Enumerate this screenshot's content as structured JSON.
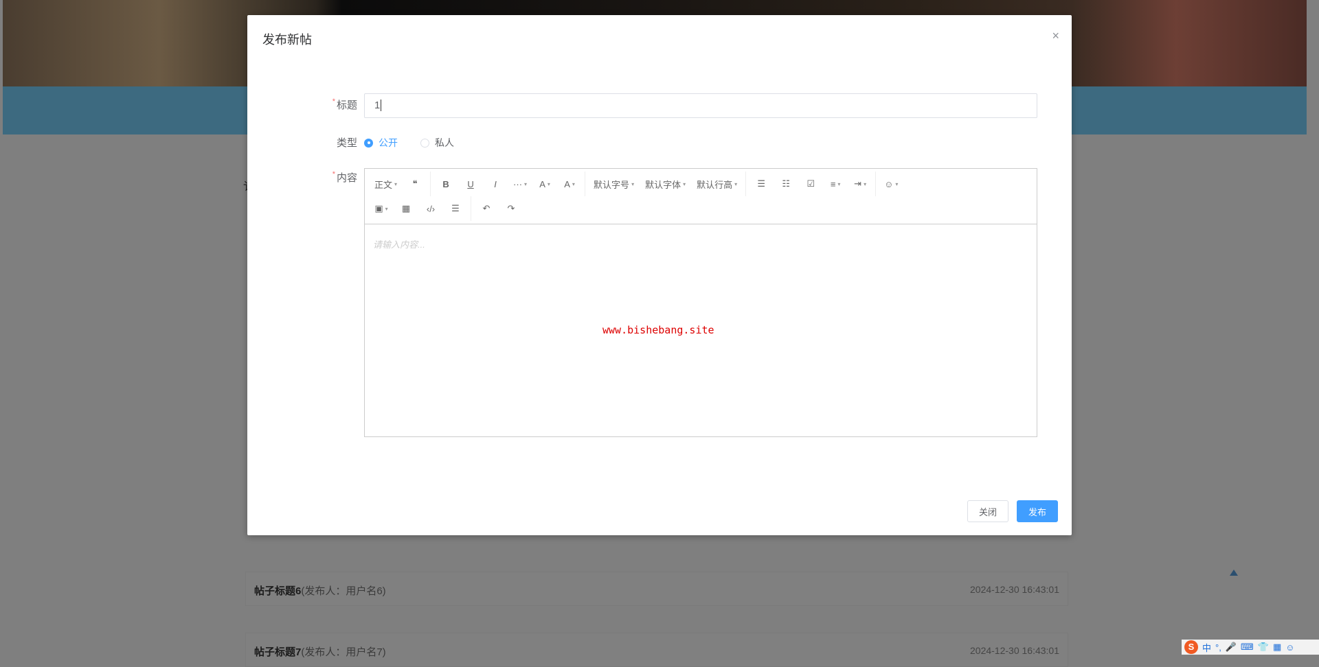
{
  "modal": {
    "title": "发布新帖",
    "close_icon": "×",
    "fields": {
      "title_label": "标题",
      "title_value": "1",
      "type_label": "类型",
      "content_label": "内容",
      "required_mark": "*"
    },
    "type_options": [
      {
        "label": "公开",
        "checked": true
      },
      {
        "label": "私人",
        "checked": false
      }
    ],
    "toolbar": {
      "row1": [
        {
          "label": "正文",
          "caret": true,
          "icon": "heading"
        },
        {
          "label": "❝",
          "icon": "quote-icon"
        },
        {
          "label": "B",
          "icon": "bold-icon"
        },
        {
          "label": "U",
          "icon": "underline-icon"
        },
        {
          "label": "I",
          "icon": "italic-icon"
        },
        {
          "label": "···",
          "caret": true,
          "icon": "more-icon"
        },
        {
          "label": "A",
          "caret": true,
          "icon": "font-color-icon"
        },
        {
          "label": "A",
          "caret": true,
          "icon": "bg-color-icon"
        },
        {
          "label": "默认字号",
          "caret": true
        },
        {
          "label": "默认字体",
          "caret": true
        },
        {
          "label": "默认行高",
          "caret": true
        },
        {
          "label": "☰",
          "icon": "bullet-list-icon"
        },
        {
          "label": "☷",
          "icon": "numbered-list-icon"
        },
        {
          "label": "☑",
          "icon": "todo-icon"
        },
        {
          "label": "≡",
          "caret": true,
          "icon": "align-icon"
        },
        {
          "label": "⇥",
          "caret": true,
          "icon": "indent-icon"
        },
        {
          "label": "☺",
          "caret": true,
          "icon": "emoji-icon"
        }
      ],
      "row2": [
        {
          "label": "▣",
          "caret": true,
          "icon": "image-icon"
        },
        {
          "label": "▦",
          "icon": "table-icon"
        },
        {
          "label": "‹/›",
          "icon": "code-icon"
        },
        {
          "label": "☰",
          "icon": "divider-icon"
        },
        {
          "label": "↶",
          "icon": "undo-icon"
        },
        {
          "label": "↷",
          "icon": "redo-icon"
        }
      ]
    },
    "placeholder": "请输入内容...",
    "watermark": "www.bishebang.site",
    "close_button": "关闭",
    "submit_button": "发布"
  },
  "background": {
    "side_char": "讠",
    "posts": [
      {
        "title": "帖子标题6",
        "author": "(发布人：用户名6)",
        "date": "2024-12-30 16:43:01"
      },
      {
        "title": "帖子标题7",
        "author": "(发布人：用户名7)",
        "date": "2024-12-30 16:43:01"
      }
    ]
  },
  "ime": {
    "logo": "S",
    "items": [
      "中",
      "°,",
      "🎤",
      "⌨",
      "👕",
      "▦",
      "☺"
    ]
  },
  "colors": {
    "primary": "#409eff",
    "watermark": "#dd0000"
  }
}
